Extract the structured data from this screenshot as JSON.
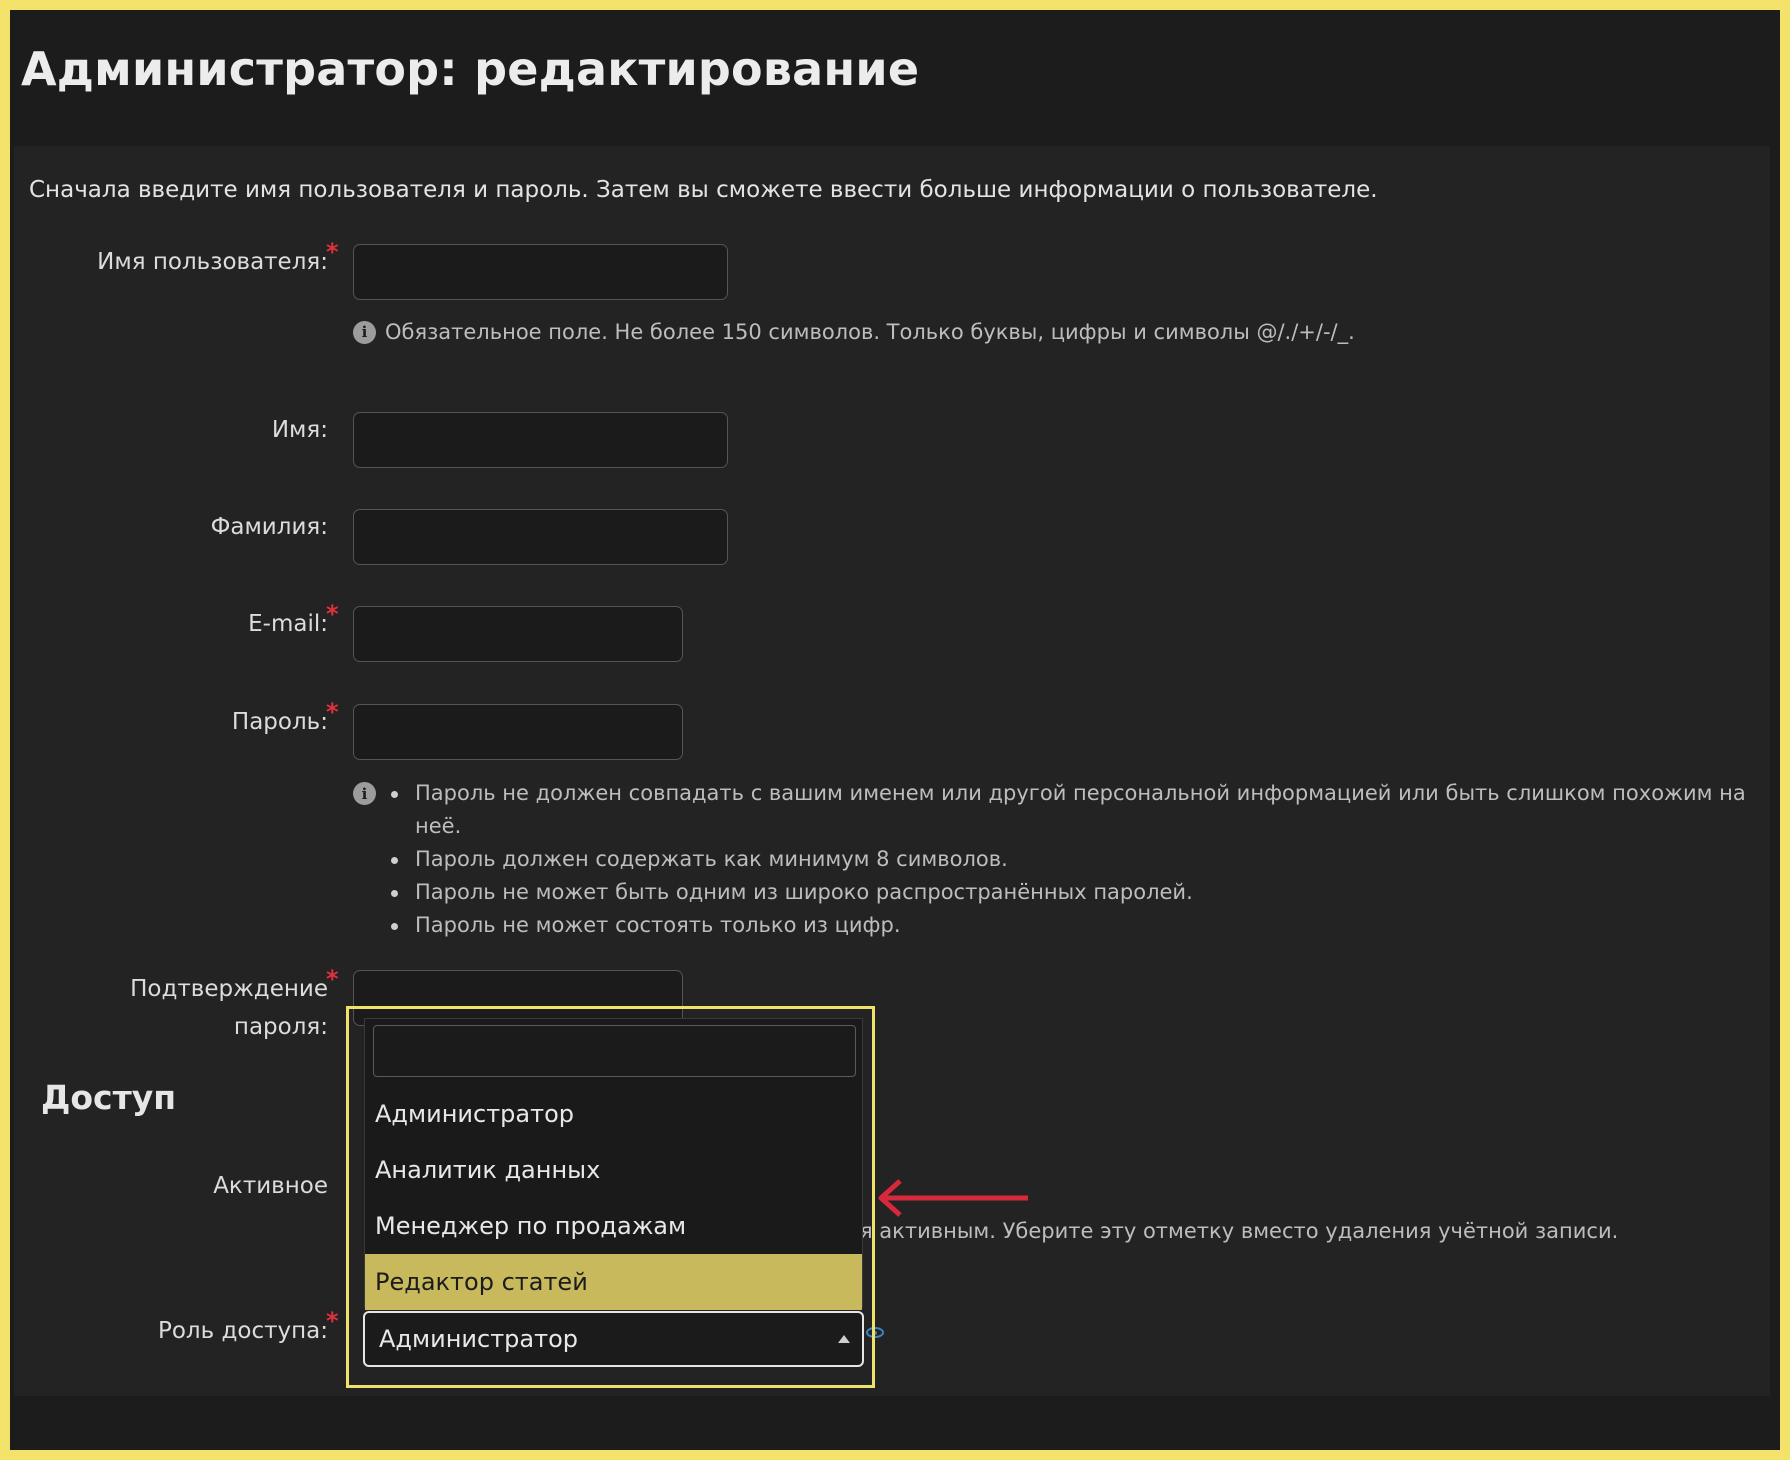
{
  "header": {
    "title": "Администратор: редактирование"
  },
  "intro": "Сначала введите имя пользователя и пароль. Затем вы сможете ввести больше информации о пользователе.",
  "form": {
    "username": {
      "label": "Имя пользователя:",
      "required": "*",
      "value": "",
      "help": "Обязательное поле. Не более 150 символов. Только буквы, цифры и символы @/./+/-/_."
    },
    "first_name": {
      "label": "Имя:",
      "value": ""
    },
    "last_name": {
      "label": "Фамилия:",
      "value": ""
    },
    "email": {
      "label": "E-mail:",
      "required": "*",
      "value": ""
    },
    "password": {
      "label": "Пароль:",
      "required": "*",
      "value": "",
      "help": [
        "Пароль не должен совпадать с вашим именем или другой персональной информацией или быть слишком похожим на неё.",
        "Пароль должен содержать как минимум 8 символов.",
        "Пароль не может быть одним из широко распространённых паролей.",
        "Пароль не может состоять только из цифр."
      ]
    },
    "password_confirm": {
      "label_line1": "Подтверждение",
      "label_line2": "пароля:",
      "required": "*",
      "value": ""
    }
  },
  "access": {
    "title": "Доступ",
    "active": {
      "label": "Активное",
      "help_visible": "я активным. Уберите эту отметку вместо удаления учётной записи."
    },
    "role": {
      "label": "Роль доступа:",
      "required": "*",
      "selected": "Администратор",
      "search_value": "",
      "options": [
        "Администратор",
        "Аналитик данных",
        "Менеджер по продажам",
        "Редактор статей"
      ],
      "highlighted_index": 3
    }
  },
  "colors": {
    "background": "#1c1c1c",
    "panel": "#232323",
    "required": "#e0313d",
    "highlight": "#c8ba5c",
    "frame_outline": "#f3e36a",
    "annotation_arrow": "#d8283c",
    "eye_icon": "#3c84c4"
  }
}
